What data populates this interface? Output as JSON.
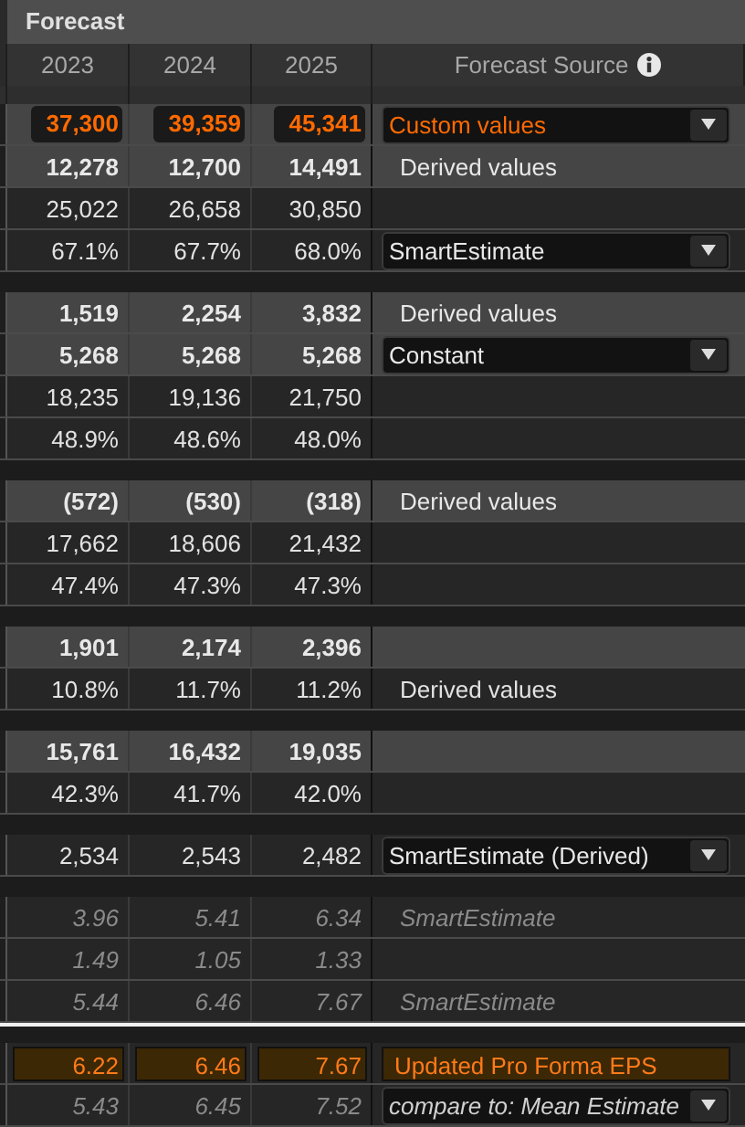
{
  "title": "Forecast",
  "columns": [
    "2023",
    "2024",
    "2025",
    "Forecast Source"
  ],
  "sections": [
    {
      "rows": [
        {
          "kind": "input",
          "values": [
            "37,300",
            "39,359",
            "45,341"
          ],
          "source": {
            "kind": "select",
            "text": "Custom values"
          }
        },
        {
          "kind": "bold",
          "values": [
            "12,278",
            "12,700",
            "14,491"
          ],
          "source": {
            "kind": "label",
            "text": "Derived values"
          }
        },
        {
          "kind": "normal",
          "values": [
            "25,022",
            "26,658",
            "30,850"
          ]
        },
        {
          "kind": "normal",
          "values": [
            "67.1%",
            "67.7%",
            "68.0%"
          ],
          "source": {
            "kind": "select",
            "text": "SmartEstimate"
          }
        }
      ]
    },
    {
      "rows": [
        {
          "kind": "bold",
          "values": [
            "1,519",
            "2,254",
            "3,832"
          ],
          "source": {
            "kind": "label",
            "text": "Derived values"
          }
        },
        {
          "kind": "bold",
          "values": [
            "5,268",
            "5,268",
            "5,268"
          ],
          "source": {
            "kind": "select",
            "text": "Constant"
          }
        },
        {
          "kind": "normal",
          "values": [
            "18,235",
            "19,136",
            "21,750"
          ]
        },
        {
          "kind": "normal",
          "values": [
            "48.9%",
            "48.6%",
            "48.0%"
          ]
        }
      ]
    },
    {
      "rows": [
        {
          "kind": "bold",
          "values": [
            "(572)",
            "(530)",
            "(318)"
          ],
          "source": {
            "kind": "label",
            "text": "Derived values"
          }
        },
        {
          "kind": "normal",
          "values": [
            "17,662",
            "18,606",
            "21,432"
          ]
        },
        {
          "kind": "normal",
          "values": [
            "47.4%",
            "47.3%",
            "47.3%"
          ]
        }
      ]
    },
    {
      "rows": [
        {
          "kind": "bold",
          "values": [
            "1,901",
            "2,174",
            "2,396"
          ]
        },
        {
          "kind": "normal",
          "values": [
            "10.8%",
            "11.7%",
            "11.2%"
          ],
          "source": {
            "kind": "label",
            "text": "Derived values"
          }
        }
      ]
    },
    {
      "rows": [
        {
          "kind": "bold",
          "values": [
            "15,761",
            "16,432",
            "19,035"
          ]
        },
        {
          "kind": "normal",
          "values": [
            "42.3%",
            "41.7%",
            "42.0%"
          ]
        }
      ]
    },
    {
      "rows": [
        {
          "kind": "normal",
          "values": [
            "2,534",
            "2,543",
            "2,482"
          ],
          "source": {
            "kind": "select",
            "text": "SmartEstimate (Derived)"
          }
        }
      ]
    },
    {
      "rows": [
        {
          "kind": "italic",
          "values": [
            "3.96",
            "5.41",
            "6.34"
          ],
          "source": {
            "kind": "label",
            "text": "SmartEstimate"
          }
        },
        {
          "kind": "italic",
          "values": [
            "1.49",
            "1.05",
            "1.33"
          ]
        },
        {
          "kind": "italic",
          "values": [
            "5.44",
            "6.46",
            "7.67"
          ],
          "source": {
            "kind": "label",
            "text": "SmartEstimate"
          }
        }
      ]
    },
    {
      "divider": true,
      "rows": [
        {
          "kind": "highlight",
          "values": [
            "6.22",
            "6.46",
            "7.67"
          ],
          "source": {
            "kind": "label",
            "text": "Updated Pro Forma EPS"
          }
        },
        {
          "kind": "italic",
          "values": [
            "5.43",
            "6.45",
            "7.52"
          ],
          "source": {
            "kind": "select",
            "text": "compare to: Mean Estimate"
          }
        }
      ]
    }
  ]
}
